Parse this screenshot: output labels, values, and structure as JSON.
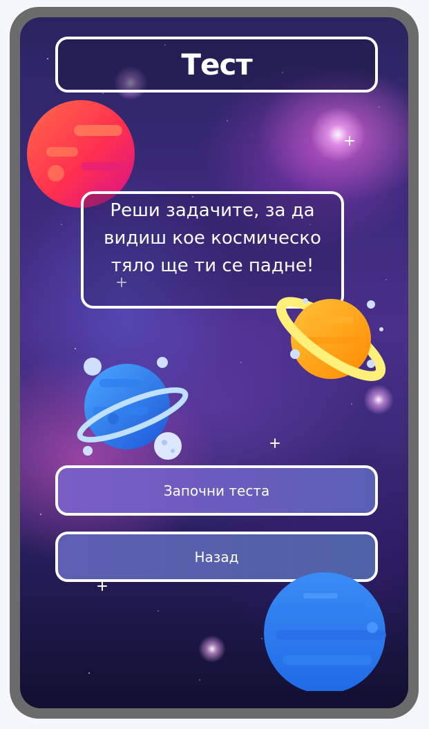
{
  "header": {
    "title": "Тест"
  },
  "intro": {
    "message": "Реши задачите, за да видиш кое космическо тяло ще ти се падне!"
  },
  "actions": {
    "start_label": "Започни теста",
    "back_label": "Назад"
  },
  "decorations": {
    "icons": [
      "red-planet-icon",
      "ringed-orange-planet-icon",
      "blue-ringed-planet-icon",
      "blue-planet-icon",
      "sparkle-icon"
    ]
  },
  "colors": {
    "frame": "#6b6b6b",
    "border": "#ffffff",
    "button_start": "#6b5cbd",
    "button_back": "#5660ab",
    "red_planet": "#ff3a4f",
    "orange_planet": "#ffa21a",
    "blue_planet": "#2d7cf0"
  }
}
